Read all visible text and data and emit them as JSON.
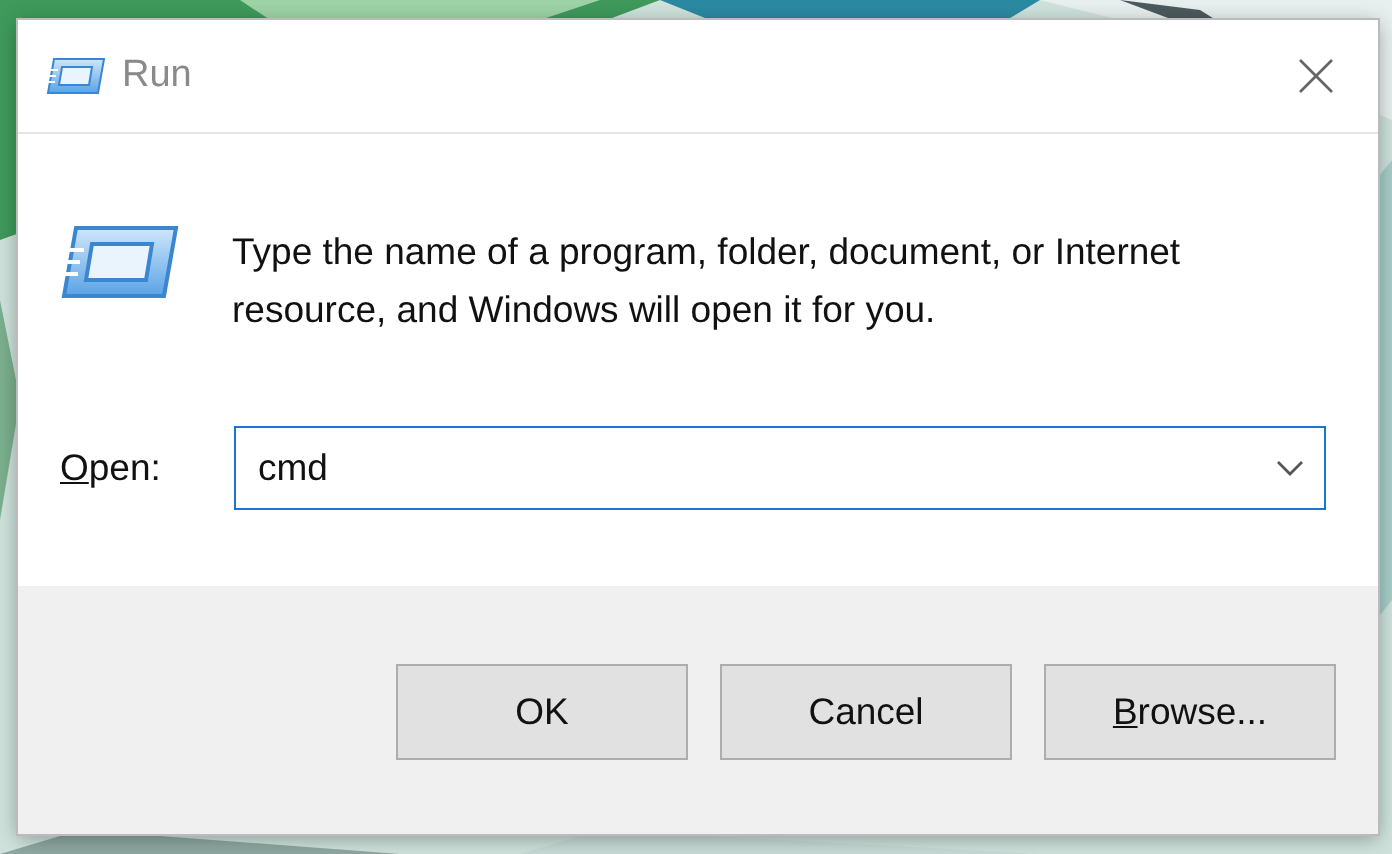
{
  "window": {
    "title": "Run"
  },
  "message": "Type the name of a program, folder, document, or Internet resource, and Windows will open it for you.",
  "open_field": {
    "label": "Open:",
    "value": "cmd",
    "focused": true
  },
  "buttons": [
    {
      "label": "OK"
    },
    {
      "label": "Cancel"
    },
    {
      "label": "Browse..."
    }
  ]
}
